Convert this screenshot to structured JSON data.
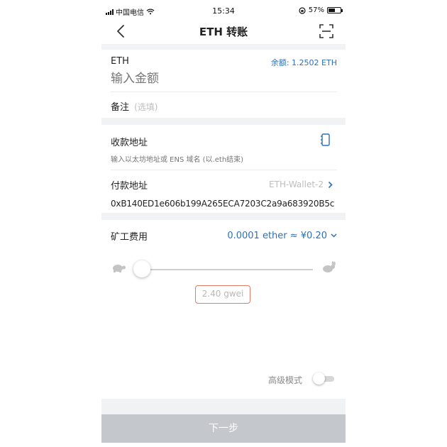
{
  "status_bar": {
    "carrier": "中国电信",
    "time": "15:34",
    "battery": "57%",
    "battery_level": 0.57
  },
  "header": {
    "title": "ETH 转账"
  },
  "amount": {
    "currency": "ETH",
    "balance": "余额: 1.2502 ETH",
    "placeholder": "输入金额"
  },
  "note": {
    "label": "备注",
    "hint": "(选填)"
  },
  "recipient": {
    "label": "收款地址",
    "placeholder": "输入以太坊地址或 ENS 域名 (以.eth结束)"
  },
  "sender": {
    "label": "付款地址",
    "wallet": "ETH-Wallet-2",
    "address": "0xB140ED1e606b199A265ECA7203C2a9a683920B5c"
  },
  "fee": {
    "label": "矿工费用",
    "value": "0.0001 ether ≈ ¥0.20",
    "gas_price": "2.40 gwei",
    "slider_level": 0.0
  },
  "advanced": {
    "label": "高级模式",
    "enabled": false
  },
  "footer": {
    "next_label": "下一步"
  },
  "colors": {
    "accent": "#2d6fbb",
    "highlight_border": "#e07b67",
    "button_disabled": "#c4c7cc",
    "divider": "#f1f2f4"
  },
  "icons": [
    "back-arrow-icon",
    "scan-icon",
    "address-book-icon",
    "chevron-right-icon",
    "chevron-down-icon",
    "turtle-icon",
    "rabbit-icon",
    "wifi-icon",
    "signal-icon",
    "battery-icon"
  ]
}
